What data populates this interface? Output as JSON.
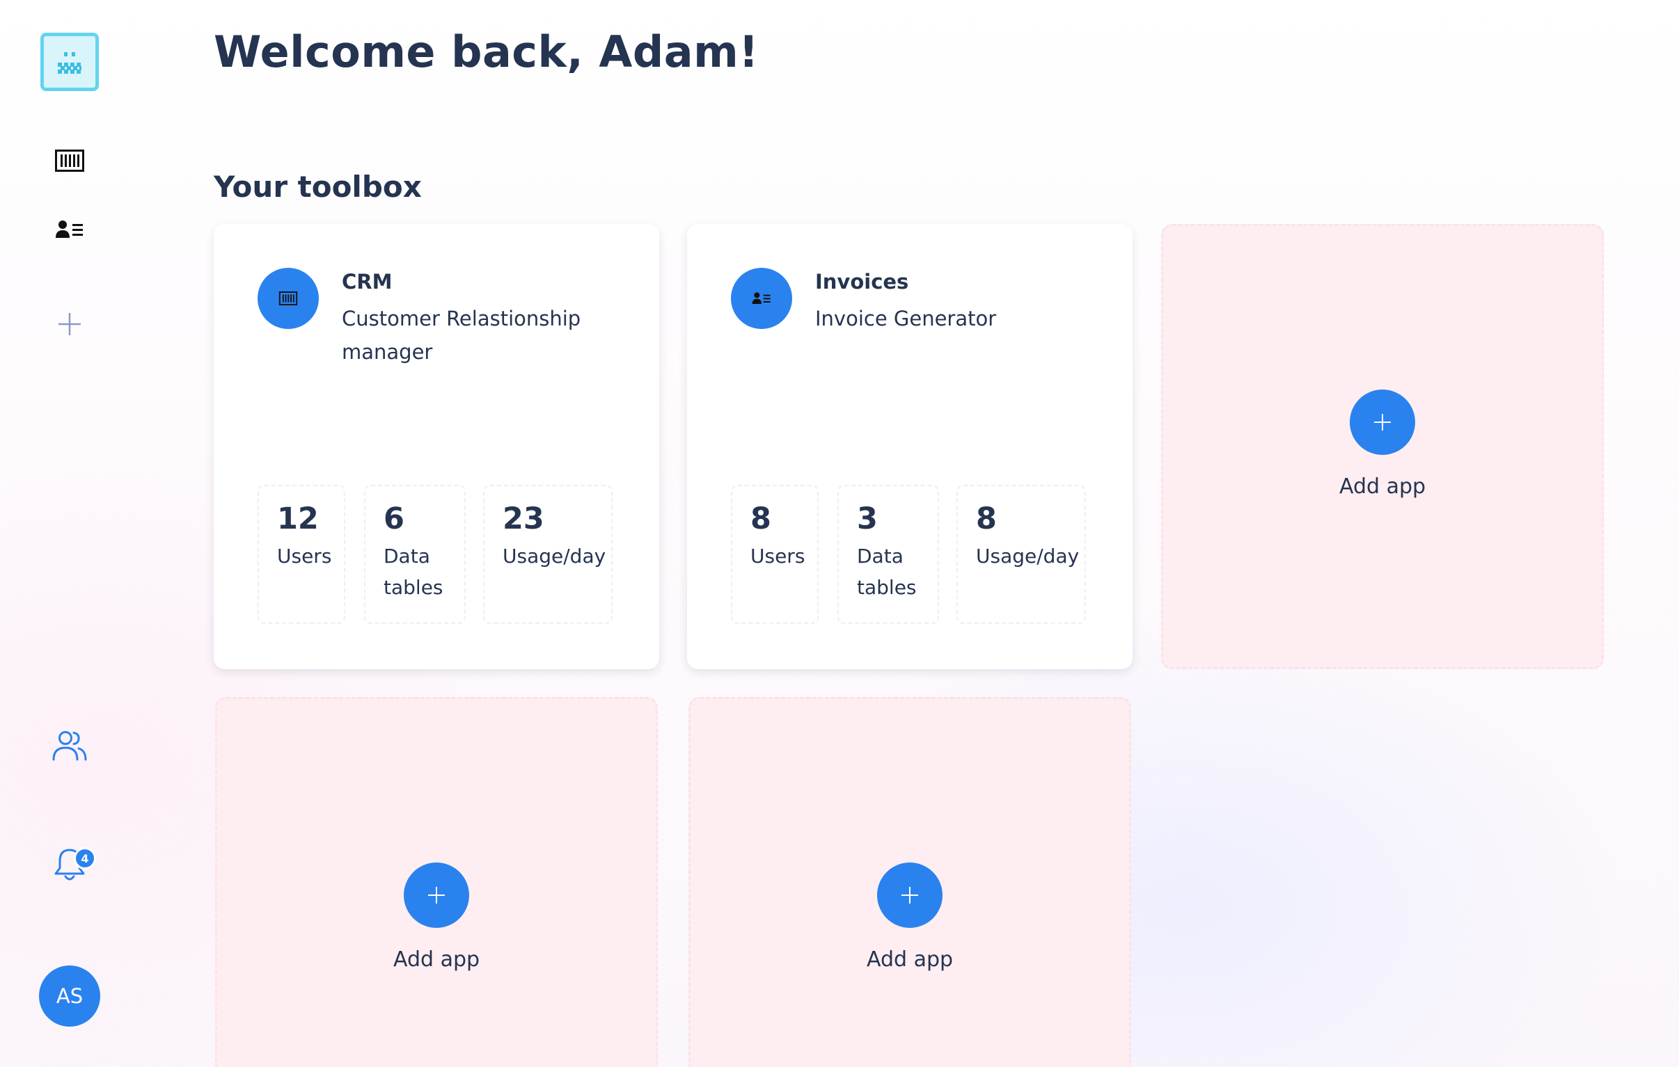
{
  "header": {
    "title": "Welcome back, Adam!"
  },
  "toolbox": {
    "title": "Your toolbox",
    "apps": [
      {
        "name": "CRM",
        "description": "Customer Relastionship manager",
        "icon": "table-icon",
        "stats": [
          {
            "value": "12",
            "label": "Users"
          },
          {
            "value": "6",
            "label": "Data tables"
          },
          {
            "value": "23",
            "label": "Usage/day"
          }
        ]
      },
      {
        "name": "Invoices",
        "description": "Invoice Generator",
        "icon": "contact-list-icon",
        "stats": [
          {
            "value": "8",
            "label": "Users"
          },
          {
            "value": "3",
            "label": "Data tables"
          },
          {
            "value": "8",
            "label": "Usage/day"
          }
        ]
      }
    ],
    "add_slots": [
      {
        "label": "Add app"
      },
      {
        "label": "Add app"
      },
      {
        "label": "Add app"
      }
    ]
  },
  "sidebar": {
    "notifications_count": "4",
    "user_initials": "AS"
  },
  "colors": {
    "accent": "#2a82ee",
    "text": "#253450",
    "add_card_bg": "#feeef2",
    "logo": "#63d4ef"
  }
}
